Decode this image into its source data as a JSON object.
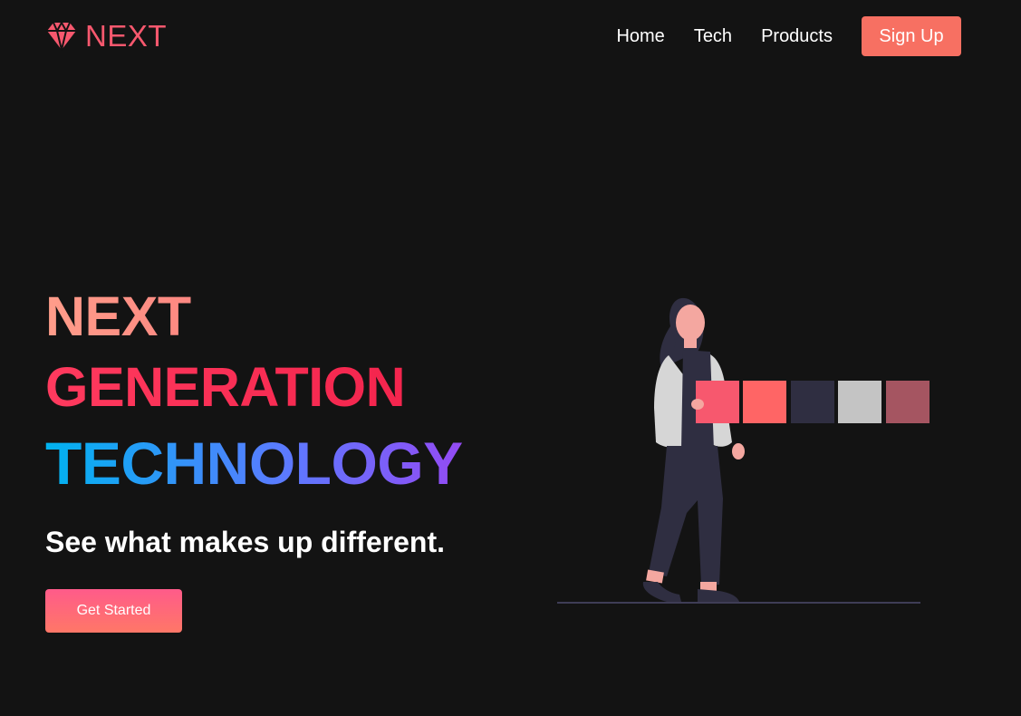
{
  "navbar": {
    "logo_text": "NEXT",
    "logo_icon": "diamond-icon",
    "links": [
      {
        "label": "Home"
      },
      {
        "label": "Tech"
      },
      {
        "label": "Products"
      }
    ],
    "signup_label": "Sign Up"
  },
  "hero": {
    "heading_line1": "NEXT",
    "heading_line2": "GENERATION",
    "heading_line3": "TECHNOLOGY",
    "subheading": "See what makes up different.",
    "cta_label": "Get Started"
  },
  "colors": {
    "background": "#131313",
    "accent": "#f77062",
    "brand_red": "#f7586e"
  }
}
